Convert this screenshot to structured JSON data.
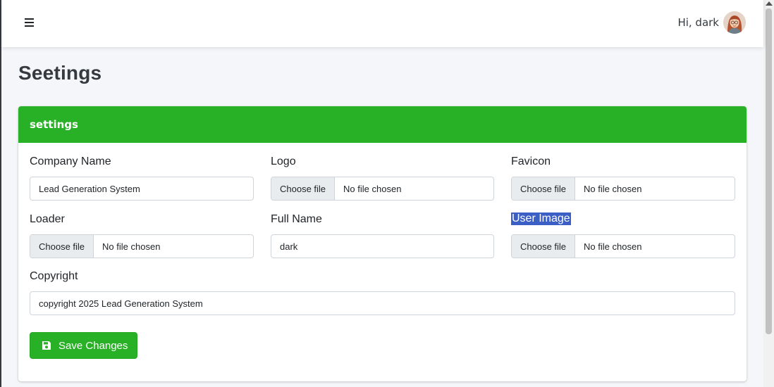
{
  "header": {
    "greeting": "Hi, dark"
  },
  "page": {
    "title": "Seetings"
  },
  "card": {
    "title": "settings"
  },
  "fields": {
    "company_name": {
      "label": "Company Name",
      "value": "Lead Generation System"
    },
    "logo": {
      "label": "Logo",
      "button": "Choose file",
      "status": "No file chosen"
    },
    "favicon": {
      "label": "Favicon",
      "button": "Choose file",
      "status": "No file chosen"
    },
    "loader": {
      "label": "Loader",
      "button": "Choose file",
      "status": "No file chosen"
    },
    "full_name": {
      "label": "Full Name",
      "value": "dark"
    },
    "user_image": {
      "label": "User Image",
      "button": "Choose file",
      "status": "No file chosen"
    },
    "copyright": {
      "label": "Copyright",
      "value": "copyright 2025 Lead Generation System"
    }
  },
  "actions": {
    "save_label": "Save Changes"
  },
  "colors": {
    "accent": "#28b126",
    "selection": "#3b5fc4"
  },
  "icons": {
    "menu": "hamburger-icon",
    "save": "floppy-disk-icon"
  }
}
